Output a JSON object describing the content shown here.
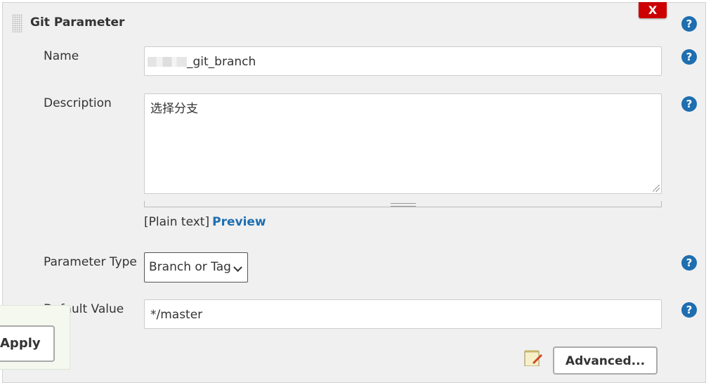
{
  "panel": {
    "title": "Git Parameter",
    "close_label": "X"
  },
  "form": {
    "name": {
      "label": "Name",
      "value": "_git_branch"
    },
    "description": {
      "label": "Description",
      "value": "选择分支"
    },
    "format": {
      "text": "[Plain text]",
      "preview_link": "Preview"
    },
    "parameter_type": {
      "label": "Parameter Type",
      "selected": "Branch or Tag"
    },
    "default_value": {
      "label": "Default Value",
      "value": "*/master"
    }
  },
  "buttons": {
    "apply": "Apply",
    "advanced": "Advanced..."
  },
  "help_icon": "?",
  "icons": [
    "grip-icon",
    "close-icon",
    "help-icon",
    "chevron-down-icon",
    "notepad-icon"
  ],
  "colors": {
    "panel_bg": "#f0f0f0",
    "close_red": "#cc0000",
    "link_blue": "#1e6eb0",
    "apply_area": "#f4f8ef"
  }
}
